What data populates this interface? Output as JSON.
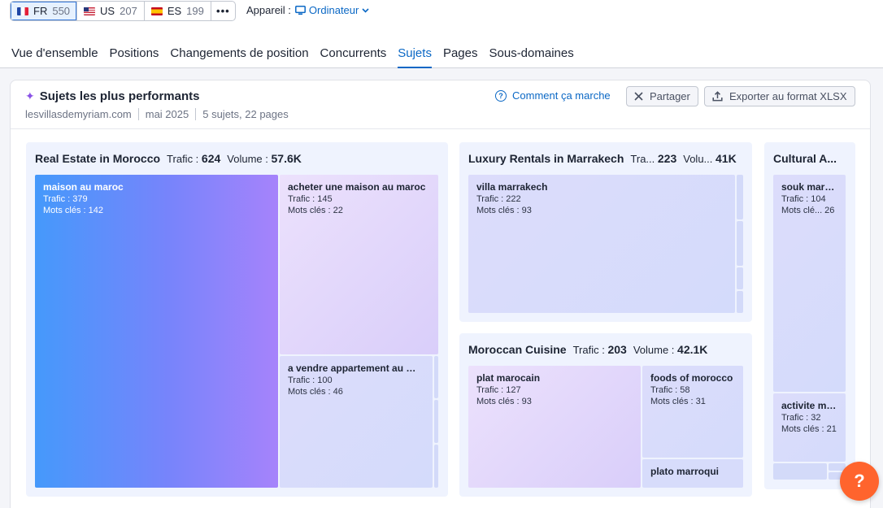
{
  "databases": [
    {
      "code": "FR",
      "count": "550",
      "flag": "flag-fr"
    },
    {
      "code": "US",
      "count": "207",
      "flag": "flag-us"
    },
    {
      "code": "ES",
      "count": "199",
      "flag": "flag-es"
    }
  ],
  "more_label": "•••",
  "device": {
    "label": "Appareil :",
    "value": "Ordinateur"
  },
  "tabs": [
    "Vue d'ensemble",
    "Positions",
    "Changements de position",
    "Concurrents",
    "Sujets",
    "Pages",
    "Sous-domaines"
  ],
  "active_tab": "Sujets",
  "card": {
    "title": "Sujets les plus performants",
    "domain": "lesvillasdemyriam.com",
    "date": "mai 2025",
    "summary": "5 sujets, 22 pages",
    "how_label": "Comment ça marche",
    "share_label": "Partager",
    "export_label": "Exporter au format XLSX"
  },
  "labels": {
    "trafic": "Trafic :",
    "volume": "Volume :",
    "mots_cles": "Mots clés :"
  },
  "groups": {
    "real_estate": {
      "title": "Real Estate in Morocco",
      "trafic_label": "Trafic :",
      "trafic": "624",
      "volume_label": "Volume :",
      "volume": "57.6K",
      "tiles": [
        {
          "name": "maison au maroc",
          "trafic": "Trafic : 379",
          "kw": "Mots clés : 142"
        },
        {
          "name": "acheter une maison au maroc",
          "trafic": "Trafic : 145",
          "kw": "Mots clés : 22"
        },
        {
          "name": "a vendre appartement au maroc",
          "trafic": "Trafic : 100",
          "kw": "Mots clés : 46"
        }
      ]
    },
    "luxury": {
      "title": "Luxury Rentals in Marrakech",
      "trafic_label": "Tra...",
      "trafic": "223",
      "volume_label": "Volu...",
      "volume": "41K",
      "tiles": [
        {
          "name": "villa marrakech",
          "trafic": "Trafic : 222",
          "kw": "Mots clés : 93"
        }
      ]
    },
    "cuisine": {
      "title": "Moroccan Cuisine",
      "trafic_label": "Trafic :",
      "trafic": "203",
      "volume_label": "Volume :",
      "volume": "42.1K",
      "tiles": [
        {
          "name": "plat marocain",
          "trafic": "Trafic : 127",
          "kw": "Mots clés : 93"
        },
        {
          "name": "foods of morocco",
          "trafic": "Trafic : 58",
          "kw": "Mots clés : 31"
        },
        {
          "name": "plato marroqui"
        }
      ]
    },
    "cultural": {
      "title": "Cultural A...",
      "tiles": [
        {
          "name": "souk marrakech",
          "trafic": "Trafic : 104",
          "kw": "Mots clé... 26"
        },
        {
          "name": "activite marrakech",
          "trafic": "Trafic : 32",
          "kw": "Mots clés : 21"
        }
      ]
    }
  },
  "help_label": "?"
}
